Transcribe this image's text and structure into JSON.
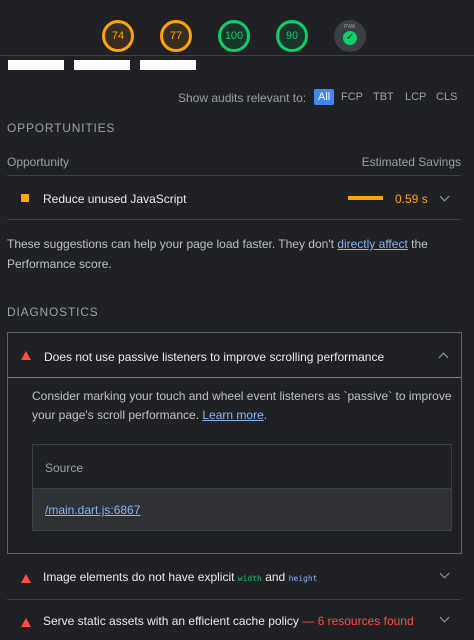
{
  "scores": [
    {
      "value": "74",
      "status": "average"
    },
    {
      "value": "77",
      "status": "average"
    },
    {
      "value": "100",
      "status": "pass"
    },
    {
      "value": "90",
      "status": "pass"
    },
    {
      "value": "",
      "label": "PWA",
      "status": "pwa"
    }
  ],
  "filter": {
    "label": "Show audits relevant to:",
    "chips": [
      "All",
      "FCP",
      "TBT",
      "LCP",
      "CLS"
    ],
    "active": "All"
  },
  "opportunities": {
    "title": "OPPORTUNITIES",
    "col_left": "Opportunity",
    "col_right": "Estimated Savings",
    "items": [
      {
        "label": "Reduce unused JavaScript",
        "savings": "0.59 s",
        "bar_fraction": 0.3
      }
    ],
    "note_pre": "These suggestions can help your page load faster. They don't ",
    "note_link": "directly affect",
    "note_post": " the Performance score."
  },
  "diagnostics": {
    "title": "DIAGNOSTICS",
    "expanded": {
      "title": "Does not use passive listeners to improve scrolling performance",
      "desc": "Consider marking your touch and wheel event listeners as `passive` to improve your page's scroll performance. ",
      "learn_more": "Learn more",
      "desc_end": ".",
      "table_header": "Source",
      "source": "/main.dart.js:6867"
    },
    "items": [
      {
        "pre": "Image elements do not have explicit ",
        "code1": "width",
        "mid": " and ",
        "code2": "height"
      },
      {
        "title": "Serve static assets with an efficient cache policy",
        "found": " — 6 resources found"
      }
    ]
  },
  "colors": {
    "orange": "#ffa400",
    "green": "#0cce6b",
    "red": "#ff4e42",
    "blue": "#4285f4"
  }
}
